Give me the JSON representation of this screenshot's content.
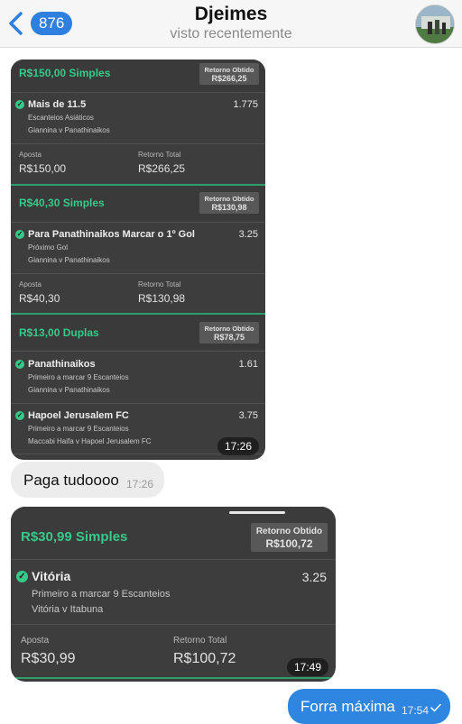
{
  "header": {
    "back_count": "876",
    "contact_name": "Djeimes",
    "status": "visto recentemente"
  },
  "msg1": {
    "time": "17:26",
    "bets": [
      {
        "title": "R$150,00 Simples",
        "return_label": "Retorno Obtido",
        "return_value": "R$266,25",
        "selections": [
          {
            "name": "Mais de 11.5",
            "odds": "1.775",
            "market": "Escanteios Asiáticos",
            "match": "Giannina v Panathinaikos"
          }
        ],
        "stake_label": "Aposta",
        "stake": "R$150,00",
        "total_label": "Retorno Total",
        "total": "R$266,25"
      },
      {
        "title": "R$40,30 Simples",
        "return_label": "Retorno Obtido",
        "return_value": "R$130,98",
        "selections": [
          {
            "name": "Para Panathinaikos Marcar o 1º Gol",
            "odds": "3.25",
            "market": "Próximo Gol",
            "match": "Giannina v Panathinaikos"
          }
        ],
        "stake_label": "Aposta",
        "stake": "R$40,30",
        "total_label": "Retorno Total",
        "total": "R$130,98"
      },
      {
        "title": "R$13,00 Duplas",
        "return_label": "Retorno Obtido",
        "return_value": "R$78,75",
        "selections": [
          {
            "name": "Panathinaikos",
            "odds": "1.61",
            "market": "Primeiro a marcar 9 Escanteios",
            "match": "Giannina v Panathinaikos"
          },
          {
            "name": "Hapoel Jerusalem FC",
            "odds": "3.75",
            "market": "Primeiro a marcar 9 Escanteios",
            "match": "Maccabi Haifa v Hapoel Jerusalem FC"
          }
        ]
      }
    ]
  },
  "msg2": {
    "text": "Paga tudoooo",
    "time": "17:26"
  },
  "msg3": {
    "time": "17:49",
    "title": "R$30,99 Simples",
    "return_label": "Retorno Obtido",
    "return_value": "R$100,72",
    "selection": {
      "name": "Vitória",
      "odds": "3.25",
      "market": "Primeiro a marcar 9 Escanteios",
      "match": "Vitória v Itabuna"
    },
    "stake_label": "Aposta",
    "stake": "R$30,99",
    "total_label": "Retorno Total",
    "total": "R$100,72"
  },
  "msg4": {
    "text": "Forra máxima",
    "time": "17:54"
  },
  "colors": {
    "accent_green": "#37c88a",
    "ios_blue": "#2f86e0",
    "slip_bg": "#3d3d3d"
  },
  "icons": [
    "chevron-left-icon",
    "check-circle-icon",
    "single-tick-icon"
  ]
}
